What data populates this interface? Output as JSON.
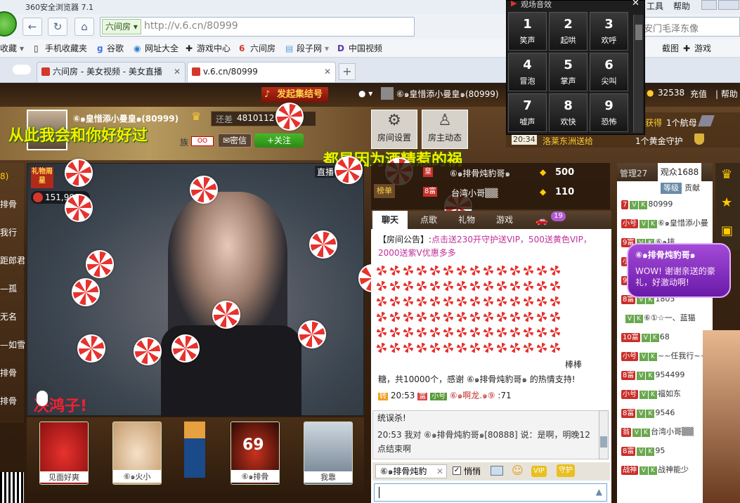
{
  "browser": {
    "title": "360安全浏览器 7.1",
    "title_right": [
      "工具",
      "帮助"
    ],
    "address_prefix": "六间房",
    "address": "http://v.6.cn/80999",
    "search": "天安门毛泽东像",
    "bookmarks": [
      "收藏",
      "手机收藏夹",
      "谷歌",
      "网址大全",
      "游戏中心",
      "六间房",
      "段子网",
      "中国视频"
    ],
    "bm_right": [
      "截图",
      "游戏"
    ],
    "tabs": [
      {
        "label": "六间房 - 美女视频 - 美女直播"
      },
      {
        "label": "v.6.cn/80999"
      }
    ],
    "tab_add": "+"
  },
  "sound_panel": {
    "title": "观场音效",
    "keys": [
      {
        "n": "1",
        "l": "笑声"
      },
      {
        "n": "2",
        "l": "起哄"
      },
      {
        "n": "3",
        "l": "欢呼"
      },
      {
        "n": "4",
        "l": "冒泡"
      },
      {
        "n": "5",
        "l": "掌声"
      },
      {
        "n": "6",
        "l": "尖叫"
      },
      {
        "n": "7",
        "l": "嘘声"
      },
      {
        "n": "8",
        "l": "欢快"
      },
      {
        "n": "9",
        "l": "恐怖"
      }
    ]
  },
  "page_top": {
    "gather": "发起集结号",
    "user": "⑥๑皇惜添小曼皇๑(80999)",
    "coins": "32538",
    "recharge": "充值",
    "help": "帮助",
    "obtained": "获得",
    "obtained_detail": "1个航母",
    "time": "20:34",
    "notice_name": "洛莱东洲送给",
    "notice_gift": "1个黄金守护"
  },
  "host": {
    "name": "⑥๑皇惜添小曼皇๑(80999)",
    "tribe": "族",
    "exp_label": "还差",
    "exp_value": "4810112",
    "message": "密信",
    "follow": "+关注",
    "room_settings": "房间设置",
    "host_news": "房主动态",
    "slogan1": "从此我会和你好好过",
    "slogan2": "都是因为酒精惹的祸"
  },
  "video": {
    "gift_label": "礼物周星",
    "wealth": "151,999",
    "live": "直播",
    "subtitle": "决鸿子!"
  },
  "left_list": [
    "8)",
    "排骨",
    "我行",
    "距郎君",
    "—孤",
    "无名",
    "—如雪",
    "排骨",
    "排骨"
  ],
  "rank": {
    "tab": "榜单",
    "row1_level": "皇",
    "row1_name": "⑥๑排骨炖豹哥๑",
    "row1_score": "500",
    "row2_level": "8富",
    "row2_name": "台湾小哥▒▒",
    "row2_score": "110"
  },
  "chat_tabs": [
    "聊天",
    "点歌",
    "礼物",
    "游戏"
  ],
  "car_count": "19",
  "chat": {
    "announce_prefix": "【房间公告】:",
    "announce": "点击送230开守护送VIP，500送黄色VIP，2000送紫V优惠多多",
    "lollipop_tail": "棒棒",
    "thanks": "糖，共10000个，感谢 ⑥๑排骨炖豹哥๑ 的热情支持!",
    "line2_time": "20:53",
    "line2_tag": "小号",
    "line2_name": "⑥๑啊龙.๑⑨",
    "line2_text": ":71",
    "err": "统误杀!",
    "line3": "20:53 我对 ⑥๑排骨炖豹哥๑[80888] 说：是啊，明晚12点结束啊",
    "input_target": "⑥๑排骨炖豹",
    "whisper": "悄悄"
  },
  "right_panel": {
    "tabs": [
      "管理27",
      "观众1688"
    ],
    "subtabs": [
      "等级",
      "贡献"
    ],
    "users": [
      {
        "lvl": "7",
        "name": "80999"
      },
      {
        "lvl": "小号",
        "name": "⑥๑皇惜添小曼"
      },
      {
        "lvl": "9富",
        "name": "⑥๑排"
      },
      {
        "lvl": "小号",
        "name": ""
      },
      {
        "lvl": "9富",
        "name": "明光管店的"
      },
      {
        "lvl": "8富",
        "name": "1805"
      },
      {
        "lvl": "",
        "name": "⑥①☆一、蓝猫"
      },
      {
        "lvl": "10富",
        "name": "68"
      },
      {
        "lvl": "小号",
        "name": "~~任我行~~"
      },
      {
        "lvl": "8富",
        "name": "954499"
      },
      {
        "lvl": "小号",
        "name": "福如东"
      },
      {
        "lvl": "8富",
        "name": "9546"
      },
      {
        "lvl": "翁",
        "name": "台湾小哥▒▒"
      },
      {
        "lvl": "8富",
        "name": "95"
      },
      {
        "lvl": "战神",
        "name": "战神能少"
      }
    ],
    "bubble_name": "⑥๑排骨炖豹哥๑",
    "bubble_text": "WOW! 谢谢亲送的豪礼，好激动啊!"
  },
  "gifts": [
    "见面好爽",
    "⑥๑火小",
    "",
    "⑥๑排骨",
    "我靠"
  ]
}
